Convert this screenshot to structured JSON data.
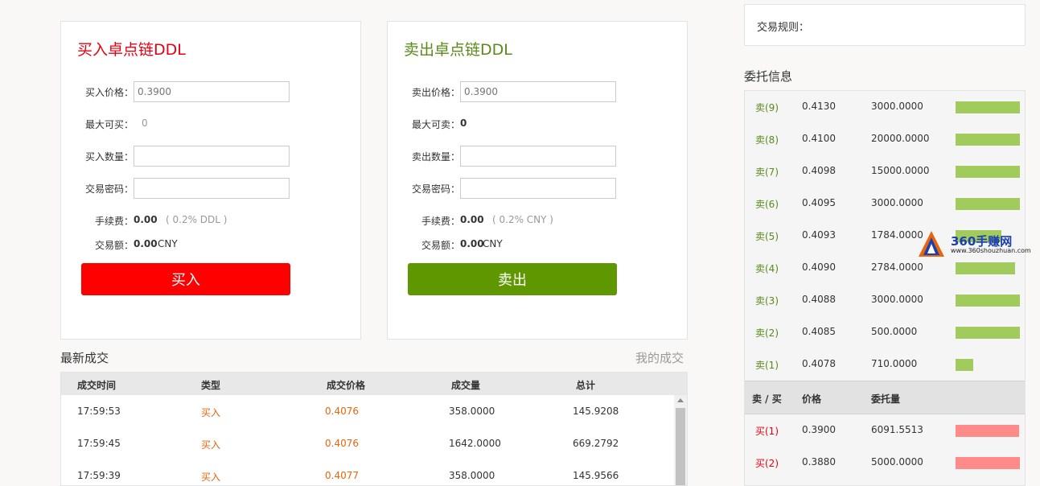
{
  "buy": {
    "title": "买入卓点链DDL",
    "price_label": "买入价格：",
    "price_placeholder": "0.3900",
    "max_label": "最大可买：",
    "max_value": "0",
    "qty_label": "买入数量：",
    "pwd_label": "交易密码：",
    "fee_label": "手续费：",
    "fee_value": "0.00",
    "fee_note": "( 0.2% DDL )",
    "amount_label": "交易额：",
    "amount_value": "0.00",
    "amount_unit": "CNY",
    "button": "买入"
  },
  "sell": {
    "title": "卖出卓点链DDL",
    "price_label": "卖出价格：",
    "price_placeholder": "0.3900",
    "max_label": "最大可卖：",
    "max_value": "0",
    "qty_label": "卖出数量：",
    "pwd_label": "交易密码：",
    "fee_label": "手续费：",
    "fee_value": "0.00",
    "fee_note": "( 0.2% CNY )",
    "amount_label": "交易额：",
    "amount_value": "0.00",
    "amount_unit": "CNY",
    "button": "卖出"
  },
  "latest": {
    "title": "最新成交",
    "my_link": "我的成交",
    "headers": [
      "成交时间",
      "类型",
      "成交价格",
      "成交量",
      "总计"
    ],
    "rows": [
      {
        "time": "17:59:53",
        "type": "买入",
        "price": "0.4076",
        "qty": "358.0000",
        "total": "145.9208"
      },
      {
        "time": "17:59:45",
        "type": "买入",
        "price": "0.4076",
        "qty": "1642.0000",
        "total": "669.2792"
      },
      {
        "time": "17:59:39",
        "type": "买入",
        "price": "0.4077",
        "qty": "358.0000",
        "total": "145.9566"
      }
    ]
  },
  "rules": {
    "label": "交易规则："
  },
  "orders": {
    "title": "委托信息",
    "sells": [
      {
        "label": "卖(9)",
        "price": "0.4130",
        "qty": "3000.0000",
        "fill": 1.0
      },
      {
        "label": "卖(8)",
        "price": "0.4100",
        "qty": "20000.0000",
        "fill": 1.0
      },
      {
        "label": "卖(7)",
        "price": "0.4098",
        "qty": "15000.0000",
        "fill": 1.0
      },
      {
        "label": "卖(6)",
        "price": "0.4095",
        "qty": "3000.0000",
        "fill": 1.0
      },
      {
        "label": "卖(5)",
        "price": "0.4093",
        "qty": "1784.0000",
        "fill": 0.71
      },
      {
        "label": "卖(4)",
        "price": "0.4090",
        "qty": "2784.0000",
        "fill": 0.93
      },
      {
        "label": "卖(3)",
        "price": "0.4088",
        "qty": "3000.0000",
        "fill": 1.0
      },
      {
        "label": "卖(2)",
        "price": "0.4085",
        "qty": "500.0000",
        "fill": 1.0
      },
      {
        "label": "卖(1)",
        "price": "0.4078",
        "qty": "710.0000",
        "fill": 0.28
      }
    ],
    "headers": [
      "卖 / 买",
      "价格",
      "委托量"
    ],
    "buys": [
      {
        "label": "买(1)",
        "price": "0.3900",
        "qty": "6091.5513",
        "fill": 0.99
      },
      {
        "label": "买(2)",
        "price": "0.3880",
        "qty": "5000.0000",
        "fill": 1.0
      }
    ]
  },
  "watermark": {
    "text": "360手赚网",
    "sub": "www.360shouzhuan.com"
  },
  "colors": {
    "buy": "#ff0000",
    "sell": "#5e9700",
    "sell_bar": "#a2cb5e",
    "buy_bar": "#ff8a8a",
    "type_text": "#e8650c"
  }
}
